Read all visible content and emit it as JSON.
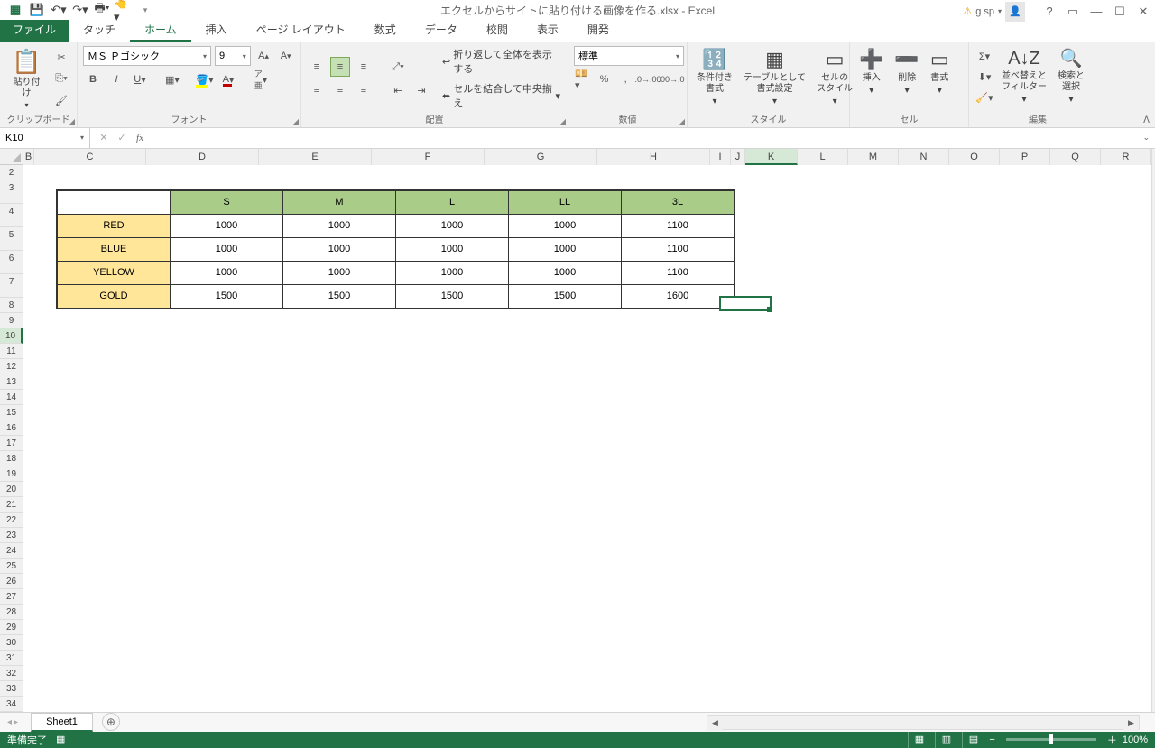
{
  "app_title": "エクセルからサイトに貼り付ける画像を作る.xlsx - Excel",
  "user": "g sp",
  "tabs": {
    "file": "ファイル",
    "touch": "タッチ",
    "home": "ホーム",
    "insert": "挿入",
    "layout": "ページ レイアウト",
    "formulas": "数式",
    "data": "データ",
    "review": "校閲",
    "view": "表示",
    "dev": "開発"
  },
  "ribbon": {
    "clipboard": {
      "paste": "貼り付け",
      "label": "クリップボード"
    },
    "font": {
      "name": "ＭＳ Ｐゴシック",
      "size": "9",
      "label": "フォント"
    },
    "align": {
      "wrap": "折り返して全体を表示する",
      "merge": "セルを結合して中央揃え",
      "label": "配置"
    },
    "number": {
      "format": "標準",
      "label": "数値"
    },
    "styles": {
      "cond": "条件付き\n書式",
      "table": "テーブルとして\n書式設定",
      "cell": "セルの\nスタイル",
      "label": "スタイル"
    },
    "cells": {
      "insert": "挿入",
      "delete": "削除",
      "format": "書式",
      "label": "セル"
    },
    "editing": {
      "sort": "並べ替えと\nフィルター",
      "find": "検索と\n選択",
      "label": "編集"
    }
  },
  "namebox": "K10",
  "cols": [
    "B",
    "C",
    "D",
    "E",
    "F",
    "G",
    "H",
    "I",
    "J",
    "K",
    "L",
    "M",
    "N",
    "O",
    "P",
    "Q",
    "R"
  ],
  "col_widths": {
    "B": 12,
    "C": 124,
    "D": 125,
    "E": 125,
    "F": 125,
    "G": 125,
    "H": 125,
    "I": 23,
    "J": 16,
    "K": 58,
    "L": 56,
    "M": 56,
    "N": 56,
    "O": 56,
    "P": 56,
    "Q": 56,
    "R": 56
  },
  "rows": [
    2,
    3,
    4,
    5,
    6,
    7,
    8,
    9,
    10,
    11,
    12,
    13,
    14,
    15,
    16,
    17,
    18,
    19,
    20,
    21,
    22,
    23,
    24,
    25,
    26,
    27,
    28,
    29,
    30,
    31,
    32,
    33,
    34
  ],
  "table": {
    "headers": [
      "",
      "S",
      "M",
      "L",
      "LL",
      "3L"
    ],
    "rows": [
      {
        "label": "RED",
        "v": [
          "1000",
          "1000",
          "1000",
          "1000",
          "1100"
        ]
      },
      {
        "label": "BLUE",
        "v": [
          "1000",
          "1000",
          "1000",
          "1000",
          "1100"
        ]
      },
      {
        "label": "YELLOW",
        "v": [
          "1000",
          "1000",
          "1000",
          "1000",
          "1100"
        ]
      },
      {
        "label": "GOLD",
        "v": [
          "1500",
          "1500",
          "1500",
          "1500",
          "1600"
        ]
      }
    ]
  },
  "sheet": "Sheet1",
  "status": {
    "ready": "準備完了",
    "zoom": "100%"
  },
  "chart_data": {
    "type": "table",
    "title": "",
    "columns": [
      "",
      "S",
      "M",
      "L",
      "LL",
      "3L"
    ],
    "rows": [
      [
        "RED",
        1000,
        1000,
        1000,
        1000,
        1100
      ],
      [
        "BLUE",
        1000,
        1000,
        1000,
        1000,
        1100
      ],
      [
        "YELLOW",
        1000,
        1000,
        1000,
        1000,
        1100
      ],
      [
        "GOLD",
        1500,
        1500,
        1500,
        1500,
        1600
      ]
    ]
  }
}
